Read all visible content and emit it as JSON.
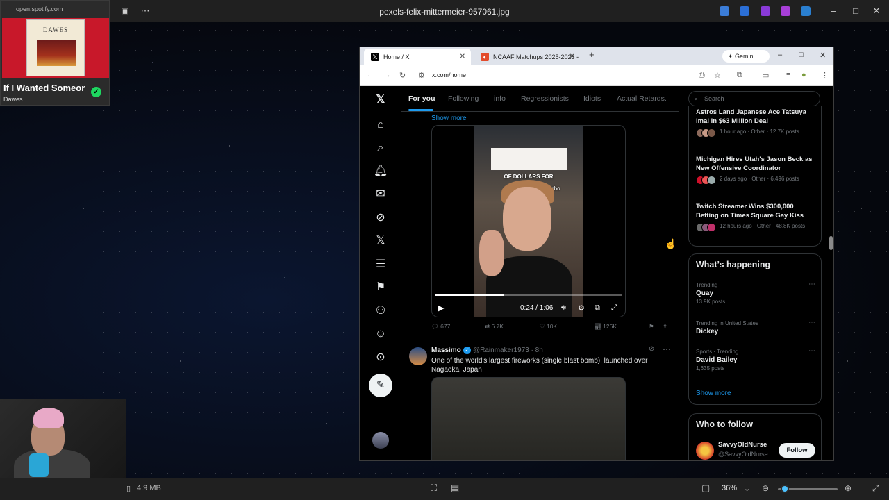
{
  "viewer": {
    "filename": "pexels-felix-mittermeier-957061.jpg",
    "file_size": "4.9 MB",
    "zoom": "36%"
  },
  "spotify": {
    "url": "open.spotify.com",
    "album_text": "DAWES",
    "song": "If I Wanted Someone",
    "artist": "Dawes"
  },
  "browser": {
    "tabs": [
      {
        "label": "Home / X",
        "icon": "x-logo-icon"
      },
      {
        "label": "NCAAF Matchups 2025-2026 -",
        "icon": "ncaaf-icon"
      }
    ],
    "gemini_label": "Gemini",
    "url": "x.com/home"
  },
  "x": {
    "feed_tabs": [
      "For you",
      "Following",
      "info",
      "Regressionists",
      "Idiots",
      "Actual Retards."
    ],
    "show_more_top": "Show more",
    "video": {
      "caption1": "OF DOLLARS FOR",
      "caption2": "bneedegsorbo",
      "time": "0:24 / 1:06",
      "progress": 0.37
    },
    "tweet1_stats": {
      "replies": "677",
      "reposts": "6.7K",
      "likes": "10K",
      "views": "126K"
    },
    "tweet2": {
      "name": "Massimo",
      "handle": "@Rainmaker1973 · 8h",
      "text": "One of the world's largest fireworks (single blast bomb), launched over Nagaoka, Japan"
    },
    "search_placeholder": "Search",
    "news": [
      {
        "title": "Astros Land Japanese Ace Tatsuya Imai in $63 Million Deal",
        "meta": "1 hour ago · Other · 12.7K posts"
      },
      {
        "title": "Michigan Hires Utah's Jason Beck as New Offensive Coordinator",
        "meta": "2 days ago · Other · 6,496 posts"
      },
      {
        "title": "Twitch Streamer Wins $300,000 Betting on Times Square Gay Kiss",
        "meta": "12 hours ago · Other · 48.8K posts"
      }
    ],
    "happening_title": "What’s happening",
    "trends": [
      {
        "context": "Trending",
        "name": "Quay",
        "posts": "13.9K posts"
      },
      {
        "context": "Trending in United States",
        "name": "Dickey",
        "posts": ""
      },
      {
        "context": "Sports · Trending",
        "name": "David Bailey",
        "posts": "1,635 posts"
      }
    ],
    "happening_show_more": "Show more",
    "who_to_follow_title": "Who to follow",
    "suggestion": {
      "name": "SavvyOldNurse",
      "handle": "@SavvyOldNurse",
      "button": "Follow"
    }
  }
}
